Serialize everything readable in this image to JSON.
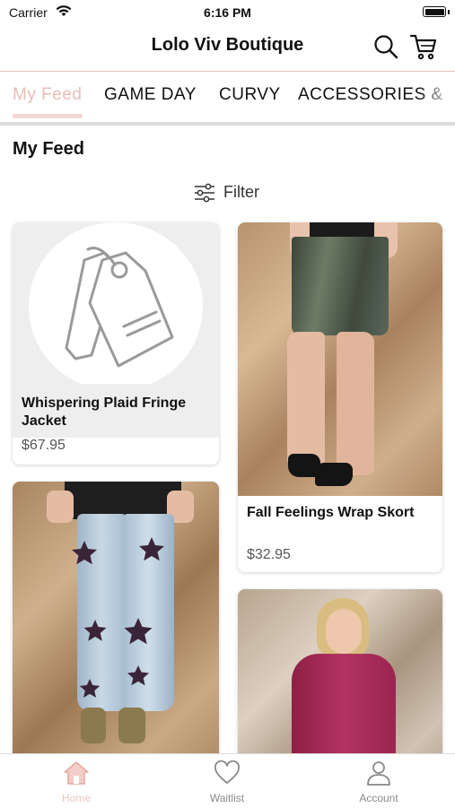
{
  "status_bar": {
    "carrier": "Carrier",
    "time": "6:16 PM"
  },
  "header": {
    "title": "Lolo Viv Boutique",
    "search_icon": "search-icon",
    "cart_icon": "cart-icon"
  },
  "tabs": [
    {
      "label": "My Feed",
      "active": true
    },
    {
      "label": "GAME DAY",
      "active": false
    },
    {
      "label": "CURVY",
      "active": false
    },
    {
      "label": "ACCESSORIES &",
      "active": false
    }
  ],
  "feed": {
    "title": "My Feed",
    "filter_label": "Filter"
  },
  "products": [
    {
      "name": "Whispering Plaid Fringe Jacket",
      "price": "$67.95",
      "image": "placeholder-tag-icon"
    },
    {
      "name": "Fall Feelings Wrap Skort",
      "price": "$32.95",
      "image": "velvet-skort-photo"
    },
    {
      "name": "",
      "price": "",
      "image": "star-jeans-photo"
    },
    {
      "name": "",
      "price": "",
      "image": "magenta-top-photo"
    }
  ],
  "bottom_tabs": [
    {
      "label": "Home",
      "icon": "home-icon",
      "active": true
    },
    {
      "label": "Waitlist",
      "icon": "heart-icon",
      "active": false
    },
    {
      "label": "Account",
      "icon": "account-icon",
      "active": false
    }
  ],
  "colors": {
    "accent": "#e7bdb6",
    "tab_underline": "#f2d8d3",
    "divider": "#dcdcdc"
  }
}
